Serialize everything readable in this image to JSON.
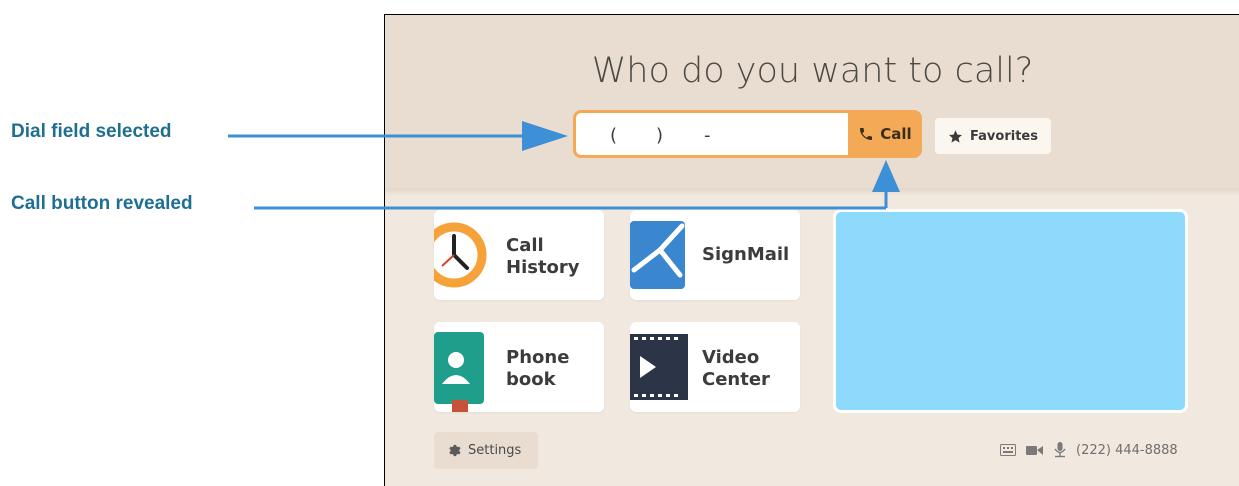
{
  "annotations": {
    "dial_field": "Dial field selected",
    "call_button": "Call button revealed"
  },
  "header": {
    "title": "Who do you want to call?"
  },
  "dial": {
    "value_parts": [
      "(",
      ")",
      "-"
    ]
  },
  "call_button": {
    "label": "Call",
    "icon": "phone-icon"
  },
  "favorites_button": {
    "label": "Favorites",
    "icon": "star-icon"
  },
  "tiles": [
    {
      "line1": "Call",
      "line2": "History",
      "icon": "clock-icon"
    },
    {
      "line1": "SignMail",
      "line2": "",
      "icon": "signmail-icon"
    },
    {
      "line1": "Phone",
      "line2": "book",
      "icon": "phonebook-icon"
    },
    {
      "line1": "Video",
      "line2": "Center",
      "icon": "film-icon"
    }
  ],
  "settings": {
    "label": "Settings",
    "icon": "gear-icon"
  },
  "status": {
    "phone_number": "(222) 444-8888"
  },
  "colors": {
    "accent": "#f3a955",
    "annotation": "#1f6f93",
    "video_preview": "#8edafd",
    "header": "#e8ddd0",
    "background": "#f1e9df"
  }
}
